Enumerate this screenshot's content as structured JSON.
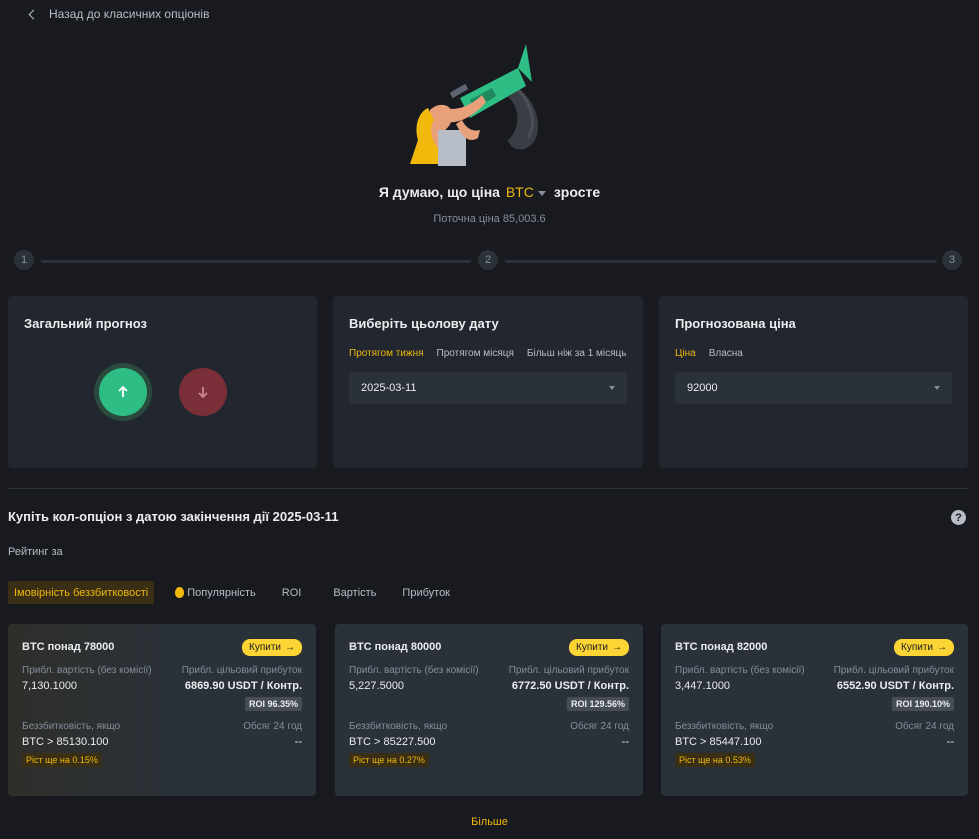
{
  "nav": {
    "back_label": "Назад до класичних опціонів"
  },
  "headline": {
    "prefix": "Я думаю, що ціна",
    "asset": "BTC",
    "suffix": "зросте"
  },
  "current_price": "Поточна ціна 85,003.6",
  "steps": [
    "1",
    "2",
    "3"
  ],
  "forecast_card": {
    "title": "Загальний прогноз"
  },
  "date_card": {
    "title": "Виберіть цьолову дату",
    "tabs": [
      "Протягом тижня",
      "Протягом місяця",
      "Більш ніж за 1 місяць"
    ],
    "selected": "2025-03-11"
  },
  "price_card": {
    "title": "Прогнозована ціна",
    "tabs": [
      "Ціна",
      "Власна"
    ],
    "selected": "92000"
  },
  "section": {
    "title": "Купіть кол-опціон з датою закінчення дії 2025-03-11",
    "help": "?",
    "rank_label": "Рейтинг за",
    "sort_tabs": [
      "Імовірність беззбитковості",
      "Популярність",
      "ROI",
      "Вартість",
      "Прибуток"
    ]
  },
  "options": [
    {
      "title": "BTC понад 78000",
      "buy": "Купити",
      "cost_label": "Прибл. вартість (без комісії)",
      "cost": "7,130.1000",
      "profit_label": "Прибл. цільовий прибуток",
      "profit": "6869.90 USDT / Контр.",
      "roi": "ROI 96.35%",
      "breakeven_label": "Беззбитковість, якщо",
      "breakeven": "BTC > 85130.100",
      "volume_label": "Обсяг 24 год",
      "volume": "--",
      "growth": "Ріст ще на 0.15%"
    },
    {
      "title": "BTC понад 80000",
      "buy": "Купити",
      "cost_label": "Прибл. вартість (без комісії)",
      "cost": "5,227.5000",
      "profit_label": "Прибл. цільовий прибуток",
      "profit": "6772.50 USDT / Контр.",
      "roi": "ROI 129.56%",
      "breakeven_label": "Беззбитковість, якщо",
      "breakeven": "BTC > 85227.500",
      "volume_label": "Обсяг 24 год",
      "volume": "--",
      "growth": "Ріст ще на 0.27%"
    },
    {
      "title": "BTC понад 82000",
      "buy": "Купити",
      "cost_label": "Прибл. вартість (без комісії)",
      "cost": "3,447.1000",
      "profit_label": "Прибл. цільовий прибуток",
      "profit": "6552.90 USDT / Контр.",
      "roi": "ROI 190.10%",
      "breakeven_label": "Беззбитковість, якщо",
      "breakeven": "BTC > 85447.100",
      "volume_label": "Обсяг 24 год",
      "volume": "--",
      "growth": "Ріст ще на 0.53%"
    }
  ],
  "more_label": "Більше",
  "colors": {
    "accent": "#f0b90b",
    "up": "#2ebd85",
    "down": "#7a2f38",
    "background": "#181a20",
    "card": "#22262e"
  }
}
